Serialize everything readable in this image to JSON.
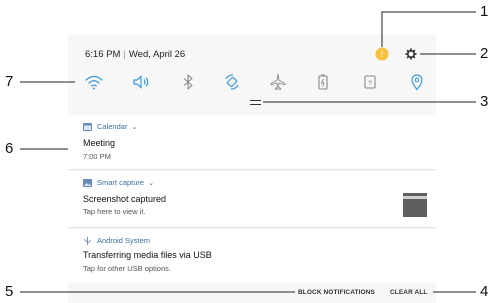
{
  "status_bar": {
    "time": "6:16 PM",
    "date": "Wed, April 26"
  },
  "quick_settings": [
    {
      "icon": "wifi-icon",
      "color": "#3a9ad9"
    },
    {
      "icon": "sound-icon",
      "color": "#3a9ad9"
    },
    {
      "icon": "bluetooth-icon",
      "color": "#888888"
    },
    {
      "icon": "auto-rotate-icon",
      "color": "#3a9ad9"
    },
    {
      "icon": "airplane-mode-icon",
      "color": "#888888"
    },
    {
      "icon": "power-saving-icon",
      "color": "#888888"
    },
    {
      "icon": "nfc-icon",
      "color": "#888888"
    },
    {
      "icon": "location-icon",
      "color": "#3a9ad9"
    }
  ],
  "notifications": [
    {
      "app": "Calendar",
      "title": "Meeting",
      "sub": "7:00 PM"
    },
    {
      "app": "Smart capture",
      "title": "Screenshot captured",
      "sub": "Tap here to view it."
    },
    {
      "app": "Android System",
      "title": "Transferring media files via USB",
      "sub": "Tap for other USB options."
    }
  ],
  "actions": {
    "block": "BLOCK NOTIFICATIONS",
    "clear": "CLEAR ALL"
  },
  "callouts": [
    "1",
    "2",
    "3",
    "4",
    "5",
    "6",
    "7"
  ],
  "colors": {
    "accent": "#3a9ad9",
    "indicator": "#f5c242",
    "panel_bg": "#f7f7f7"
  }
}
